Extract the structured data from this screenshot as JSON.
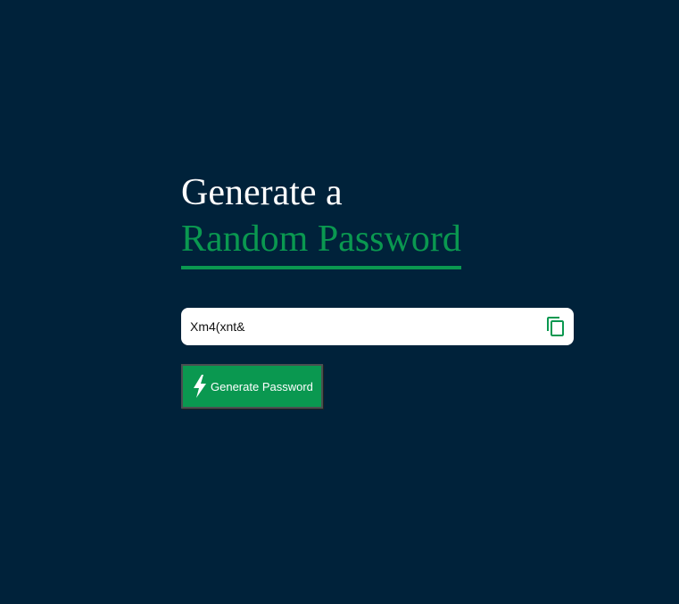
{
  "heading": {
    "line1": "Generate a",
    "line2": "Random Password"
  },
  "password": {
    "value": "Xm4(xnt&"
  },
  "icons": {
    "copy": "copy-icon",
    "generate": "lightning-bolt-icon"
  },
  "generate_button": {
    "label": "Generate Password"
  },
  "colors": {
    "background": "#00223a",
    "accent": "#0a9850",
    "heading_text": "#ffffff",
    "field_background": "#ffffff"
  }
}
